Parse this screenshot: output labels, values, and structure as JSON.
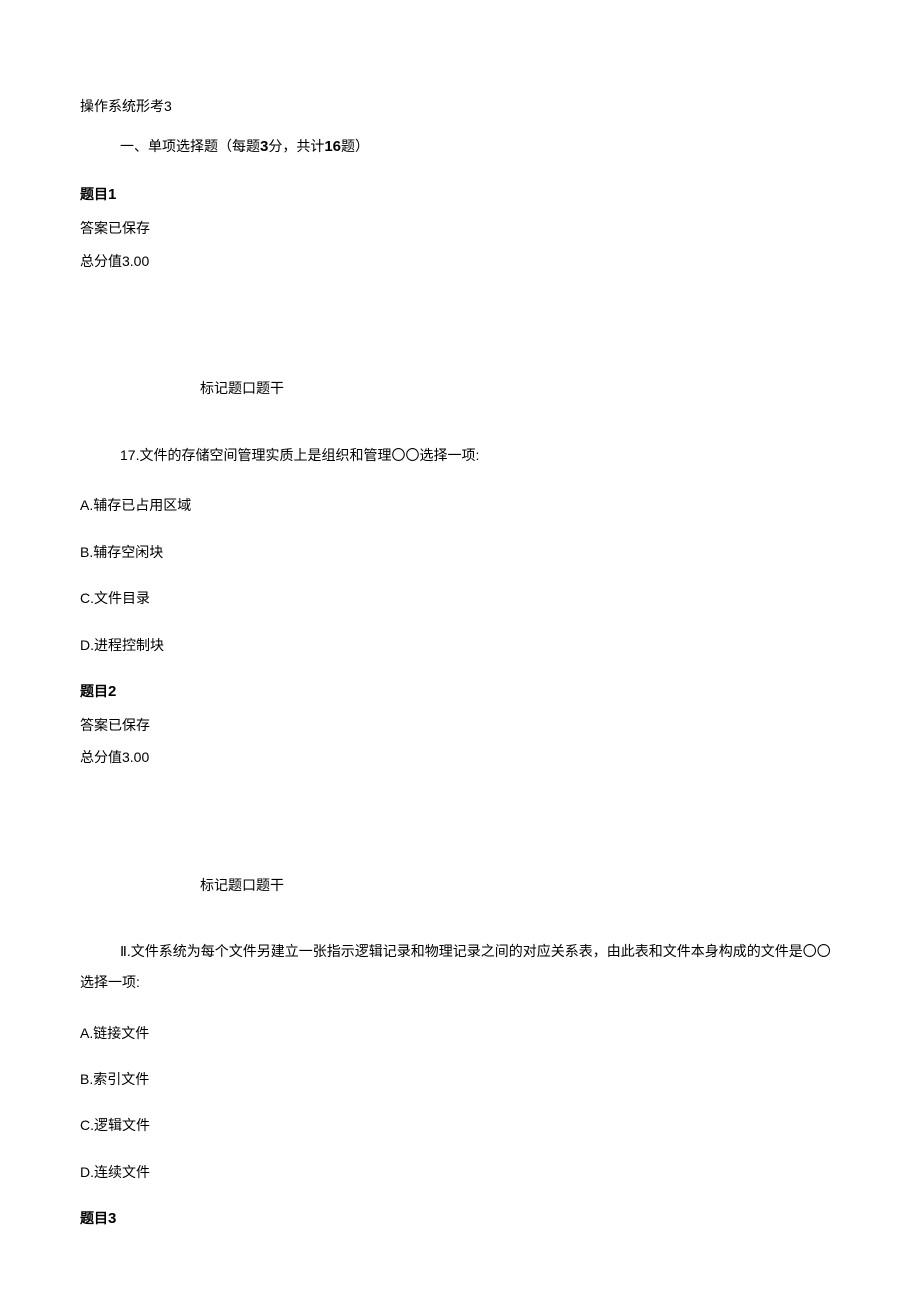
{
  "doc_title": "操作系统形考3",
  "section_header": {
    "prefix": "一、单项选择题（每题",
    "points_per_q": "3",
    "mid": "分，共计",
    "total_q": "16",
    "suffix": "题）"
  },
  "marker_label": "标记题口题干",
  "questions": [
    {
      "title_prefix": "题目",
      "number": "1",
      "status": "答案已保存",
      "score": "总分值3.00",
      "stem_num": "17.",
      "stem_text": "文件的存储空间管理实质上是组织和管理〇〇选择一项:",
      "options": [
        "A.辅存已占用区域",
        "B.辅存空闲块",
        "C.文件目录",
        "D.进程控制块"
      ]
    },
    {
      "title_prefix": "题目",
      "number": "2",
      "status": "答案已保存",
      "score": "总分值3.00",
      "stem_num": "Ⅱ.",
      "stem_text": "文件系统为每个文件另建立一张指示逻辑记录和物理记录之间的对应关系表，由此表和文件本身构成的文件是〇〇选择一项:",
      "options": [
        "A.链接文件",
        "B.索引文件",
        "C.逻辑文件",
        "D.连续文件"
      ]
    },
    {
      "title_prefix": "题目",
      "number": "3"
    }
  ]
}
